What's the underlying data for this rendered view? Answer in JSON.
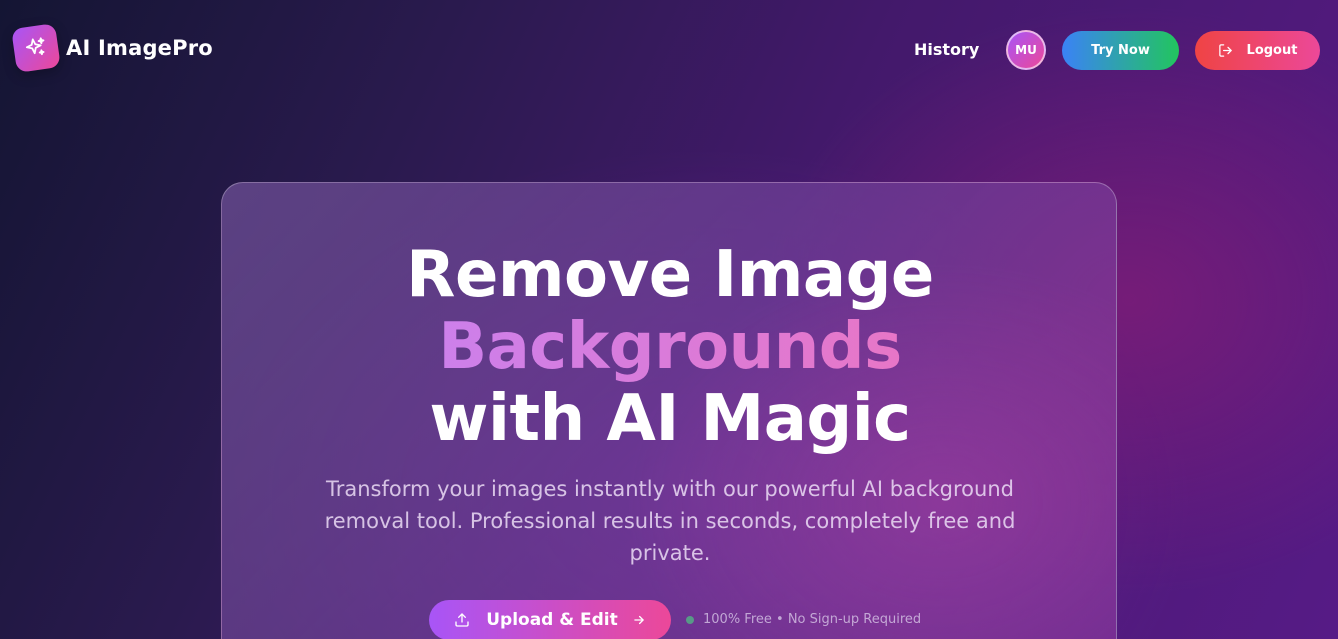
{
  "header": {
    "logo_icon": "sparkles-icon",
    "app_name": "AI ImagePro",
    "nav_history": "History",
    "avatar_initials": "MU",
    "try_now_label": "Try Now",
    "logout_label": "Logout",
    "logout_icon": "logout-icon"
  },
  "hero": {
    "title_line1": "Remove Image",
    "title_line2": "Backgrounds",
    "title_line3": "with AI Magic",
    "subtitle": "Transform your images instantly with our powerful AI background removal tool. Professional results in seconds, completely free and private.",
    "upload_label": "Upload & Edit",
    "upload_icon": "upload-icon",
    "arrow_icon": "arrow-right-icon",
    "note": "100% Free • No Sign-up Required"
  },
  "colors": {
    "brand_gradient_start": "#a855f7",
    "brand_gradient_end": "#ec4899",
    "try_gradient_start": "#3b82f6",
    "try_gradient_end": "#22c55e",
    "logout_gradient_start": "#ef4444",
    "logout_gradient_end": "#ec4899",
    "status_dot": "#4ade80"
  }
}
